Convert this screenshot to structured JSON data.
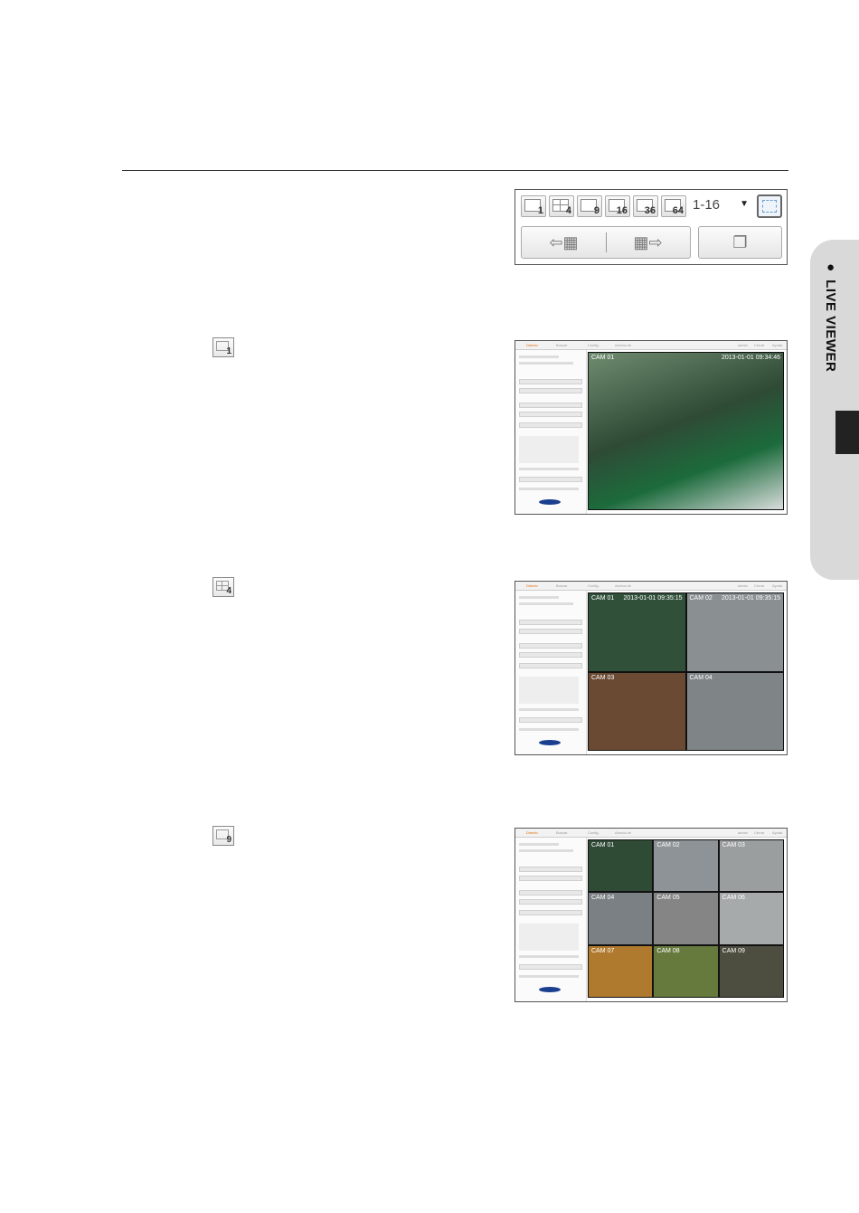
{
  "side_tab": {
    "label": "● LIVE VIEWER"
  },
  "toolbar": {
    "split_buttons": [
      "1",
      "4",
      "9",
      "16",
      "36",
      "64"
    ],
    "channel_select": "1-16"
  },
  "steps": [
    {
      "icon_number": "1"
    },
    {
      "icon_number": "4"
    },
    {
      "icon_number": "9"
    }
  ],
  "screenshot_single": {
    "cam": "CAM 01",
    "timestamp": "2013-01-01 09:34:46",
    "menu": [
      "Directo",
      "Buscar",
      "Config.",
      "Acerca de"
    ],
    "right_menu": [
      "admin",
      "Cerrar",
      "Ayuda"
    ],
    "cell_color": "#3c5a3a"
  },
  "screenshot_quad": {
    "cells": [
      {
        "cam": "CAM 01",
        "ts": "2013-01-01 09:35:15",
        "color": "#30503a"
      },
      {
        "cam": "CAM 02",
        "ts": "2013-01-01 09:35:15",
        "color": "#8a8f92"
      },
      {
        "cam": "CAM 03",
        "ts": "",
        "color": "#6b4a34"
      },
      {
        "cam": "CAM 04",
        "ts": "",
        "color": "#7f8487"
      }
    ]
  },
  "screenshot_nine": {
    "cells": [
      {
        "cam": "CAM 01",
        "color": "#2f4a35"
      },
      {
        "cam": "CAM 02",
        "color": "#8d9396"
      },
      {
        "cam": "CAM 03",
        "color": "#9a9e9f"
      },
      {
        "cam": "CAM 04",
        "color": "#7b8084"
      },
      {
        "cam": "CAM 05",
        "color": "#858585"
      },
      {
        "cam": "CAM 06",
        "color": "#a6aaab"
      },
      {
        "cam": "CAM 07",
        "color": "#b07a2e"
      },
      {
        "cam": "CAM 08",
        "color": "#677a3e"
      },
      {
        "cam": "CAM 09",
        "color": "#4d4d40"
      }
    ]
  }
}
